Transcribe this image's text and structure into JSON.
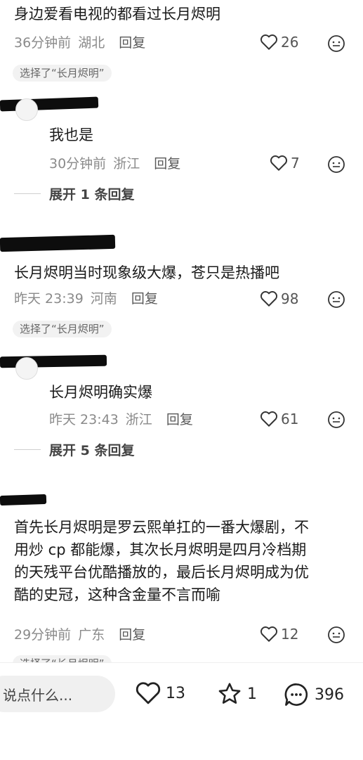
{
  "comments": [
    {
      "text": "身边爱看电视的都看过长月烬明",
      "time": "36分钟前",
      "region": "湖北",
      "reply": "回复",
      "likes": "26",
      "tag": "选择了“长月烬明”"
    },
    {
      "text": "我也是",
      "time": "30分钟前",
      "region": "浙江",
      "reply": "回复",
      "likes": "7",
      "expand": "展开 1 条回复"
    },
    {
      "text": "长月烬明当时现象级大爆，苍只是热播吧",
      "time": "昨天 23:39",
      "region": "河南",
      "reply": "回复",
      "likes": "98",
      "tag": "选择了“长月烬明”"
    },
    {
      "text": "长月烬明确实爆",
      "time": "昨天 23:43",
      "region": "浙江",
      "reply": "回复",
      "likes": "61",
      "expand": "展开 5 条回复"
    },
    {
      "text_lines": [
        "首先长月烬明是罗云熙单扛的一番大爆剧，不",
        "用炒 cp 都能爆，其次长月烬明是四月冷档期",
        "的天残平台优酷播放的，最后长月烬明成为优",
        "酷的史冠，这种含金量不言而喻"
      ],
      "time": "29分钟前",
      "region": "广东",
      "reply": "回复",
      "likes": "12",
      "tag_partial": "选择了“长月烬明”"
    }
  ],
  "bottom_bar": {
    "input_placeholder": "说点什么...",
    "likes": "13",
    "favorites": "1",
    "comments": "396"
  },
  "icons": {
    "like": "heart-outline-icon",
    "dislike": "neutral-face-icon",
    "favorite": "star-outline-icon",
    "comment": "chat-bubble-icon"
  }
}
